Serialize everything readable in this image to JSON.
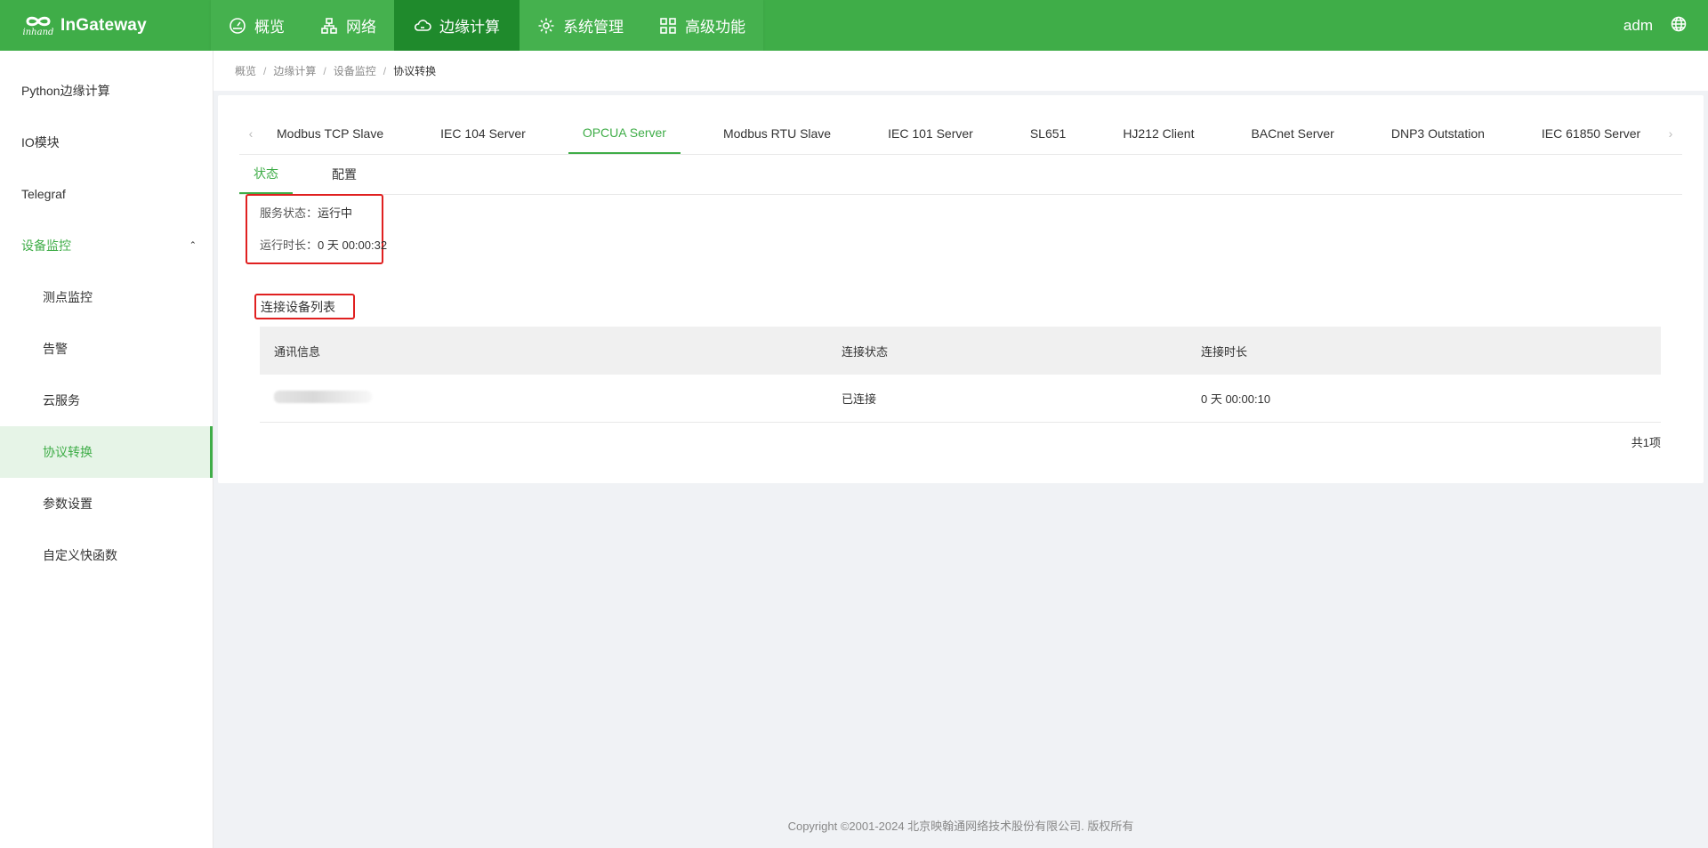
{
  "brand": {
    "name": "InGateway",
    "logo_sub": "inhand"
  },
  "topnav": {
    "items": [
      {
        "label": "概览",
        "icon": "dashboard-icon"
      },
      {
        "label": "网络",
        "icon": "network-icon"
      },
      {
        "label": "边缘计算",
        "icon": "cloud-icon"
      },
      {
        "label": "系统管理",
        "icon": "gear-icon"
      },
      {
        "label": "高级功能",
        "icon": "grid-icon"
      }
    ],
    "active_index": 2,
    "user": "adm"
  },
  "sidebar": {
    "items": [
      {
        "label": "Python边缘计算"
      },
      {
        "label": "IO模块"
      },
      {
        "label": "Telegraf"
      },
      {
        "label": "设备监控"
      },
      {
        "label": "测点监控"
      },
      {
        "label": "告警"
      },
      {
        "label": "云服务"
      },
      {
        "label": "协议转换"
      },
      {
        "label": "参数设置"
      },
      {
        "label": "自定义快函数"
      }
    ]
  },
  "breadcrumb": {
    "items": [
      "概览",
      "边缘计算",
      "设备监控",
      "协议转换"
    ],
    "separator": "/"
  },
  "tabs": {
    "items": [
      "Modbus TCP Slave",
      "IEC 104 Server",
      "OPCUA Server",
      "Modbus RTU Slave",
      "IEC 101 Server",
      "SL651",
      "HJ212 Client",
      "BACnet Server",
      "DNP3 Outstation",
      "IEC 61850 Server"
    ],
    "active": "OPCUA Server"
  },
  "subtabs": {
    "status": "状态",
    "config": "配置"
  },
  "status": {
    "service_label": "服务状态：",
    "service_value": "运行中",
    "uptime_label": "运行时长：",
    "uptime_value": "0 天 00:00:32"
  },
  "device_list": {
    "title": "连接设备列表",
    "columns": [
      "通讯信息",
      "连接状态",
      "连接时长"
    ],
    "rows": [
      {
        "status": "已连接",
        "duration": "0 天 00:00:10"
      }
    ],
    "total": "共1项"
  },
  "footer": {
    "text": "Copyright ©2001-2024 北京映翰通网络技术股份有限公司. 版权所有"
  },
  "colors": {
    "primary": "#3fad48",
    "nav_active": "#1f8a2c",
    "highlight_border": "#e02020"
  }
}
